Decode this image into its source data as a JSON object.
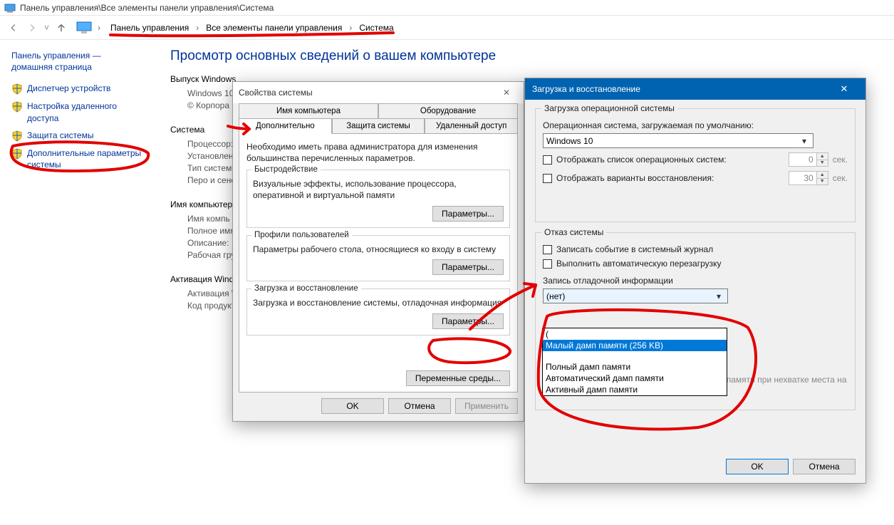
{
  "window_title": "Панель управления\\Все элементы панели управления\\Система",
  "breadcrumbs": {
    "a": "Панель управления",
    "b": "Все элементы панели управления",
    "c": "Система"
  },
  "sidebar": {
    "home1": "Панель управления —",
    "home2": "домашняя страница",
    "l0": "Диспетчер устройств",
    "l1": "Настройка удаленного доступа",
    "l2": "Защита системы",
    "l3": "Дополнительные параметры системы"
  },
  "content": {
    "page_title": "Просмотр основных сведений о вашем компьютере",
    "sect_edition": "Выпуск Windows",
    "edition_name": "Windows 10",
    "copyright": "© Корпора",
    "sect_system": "Система",
    "sys_cpu": "Процессор:",
    "sys_ram": "Установленн (ОЗУ):",
    "sys_type": "Тип системы",
    "sys_pen": "Перо и сенс",
    "sect_names": "Имя компьютер",
    "n_name": "Имя компь",
    "n_full": "Полное имя",
    "n_desc": "Описание:",
    "n_group": "Рабочая гру",
    "sect_activation": "Активация Window",
    "act_state": "Активация W",
    "act_key": "Код продукт"
  },
  "sysprops": {
    "title": "Свойства системы",
    "tabs": {
      "computer_name": "Имя компьютера",
      "hardware": "Оборудование",
      "advanced": "Дополнительно",
      "protection": "Защита системы",
      "remote": "Удаленный доступ"
    },
    "admin_note": "Необходимо иметь права администратора для изменения большинства перечисленных параметров.",
    "perf": {
      "title": "Быстродействие",
      "desc": "Визуальные эффекты, использование процессора, оперативной и виртуальной памяти",
      "btn": "Параметры..."
    },
    "profiles": {
      "title": "Профили пользователей",
      "desc": "Параметры рабочего стола, относящиеся ко входу в систему",
      "btn": "Параметры..."
    },
    "startup": {
      "title": "Загрузка и восстановление",
      "desc": "Загрузка и восстановление системы, отладочная информация",
      "btn": "Параметры..."
    },
    "env_btn": "Переменные среды...",
    "ok": "OK",
    "cancel": "Отмена",
    "apply": "Применить"
  },
  "recover": {
    "title": "Загрузка и восстановление",
    "fs_startup": "Загрузка операционной системы",
    "default_os_label": "Операционная система, загружаемая по умолчанию:",
    "default_os_value": "Windows 10",
    "chk_oslist": "Отображать список операционных систем:",
    "chk_recovery": "Отображать варианты восстановления:",
    "sec0": "0",
    "sec30": "30",
    "sec_label": "сек.",
    "fs_failure": "Отказ системы",
    "chk_log": "Записать событие в системный журнал",
    "chk_restart": "Выполнить автоматическую перезагрузку",
    "dump_label": "Запись отладочной информации",
    "dump_selected": "(нет)",
    "hidden_text": "Отключить автоматическое удаление дампов памяти при нехватке места на диске",
    "dd": {
      "i0": "(",
      "i1": "Малый дамп памяти (256 KB)",
      "i2": "",
      "i3": "Полный дамп памяти",
      "i4": "Автоматический дамп памяти",
      "i5": "Активный дамп памяти"
    },
    "ok": "OK",
    "cancel": "Отмена"
  }
}
